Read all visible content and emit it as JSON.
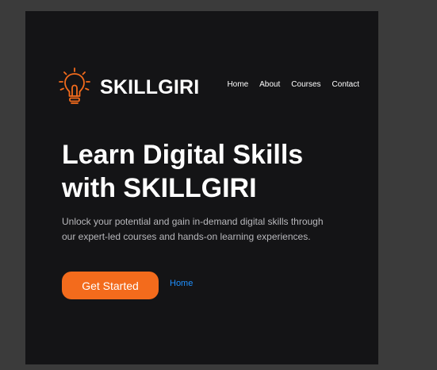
{
  "brand": {
    "name": "SKILLGIRI",
    "icon": "lightbulb-icon",
    "accent_color": "#f36b1c"
  },
  "nav": {
    "items": [
      {
        "label": "Home"
      },
      {
        "label": "About"
      },
      {
        "label": "Courses"
      },
      {
        "label": "Contact"
      }
    ]
  },
  "hero": {
    "title_line1": "Learn Digital Skills",
    "title_line2": "with SKILLGIRI",
    "subtitle": "Unlock your potential and gain in-demand digital skills through our expert-led courses and hands-on learning experiences.",
    "cta_label": "Get Started",
    "secondary_link": "Home"
  },
  "colors": {
    "background": "#141416",
    "link": "#1e90ff"
  }
}
